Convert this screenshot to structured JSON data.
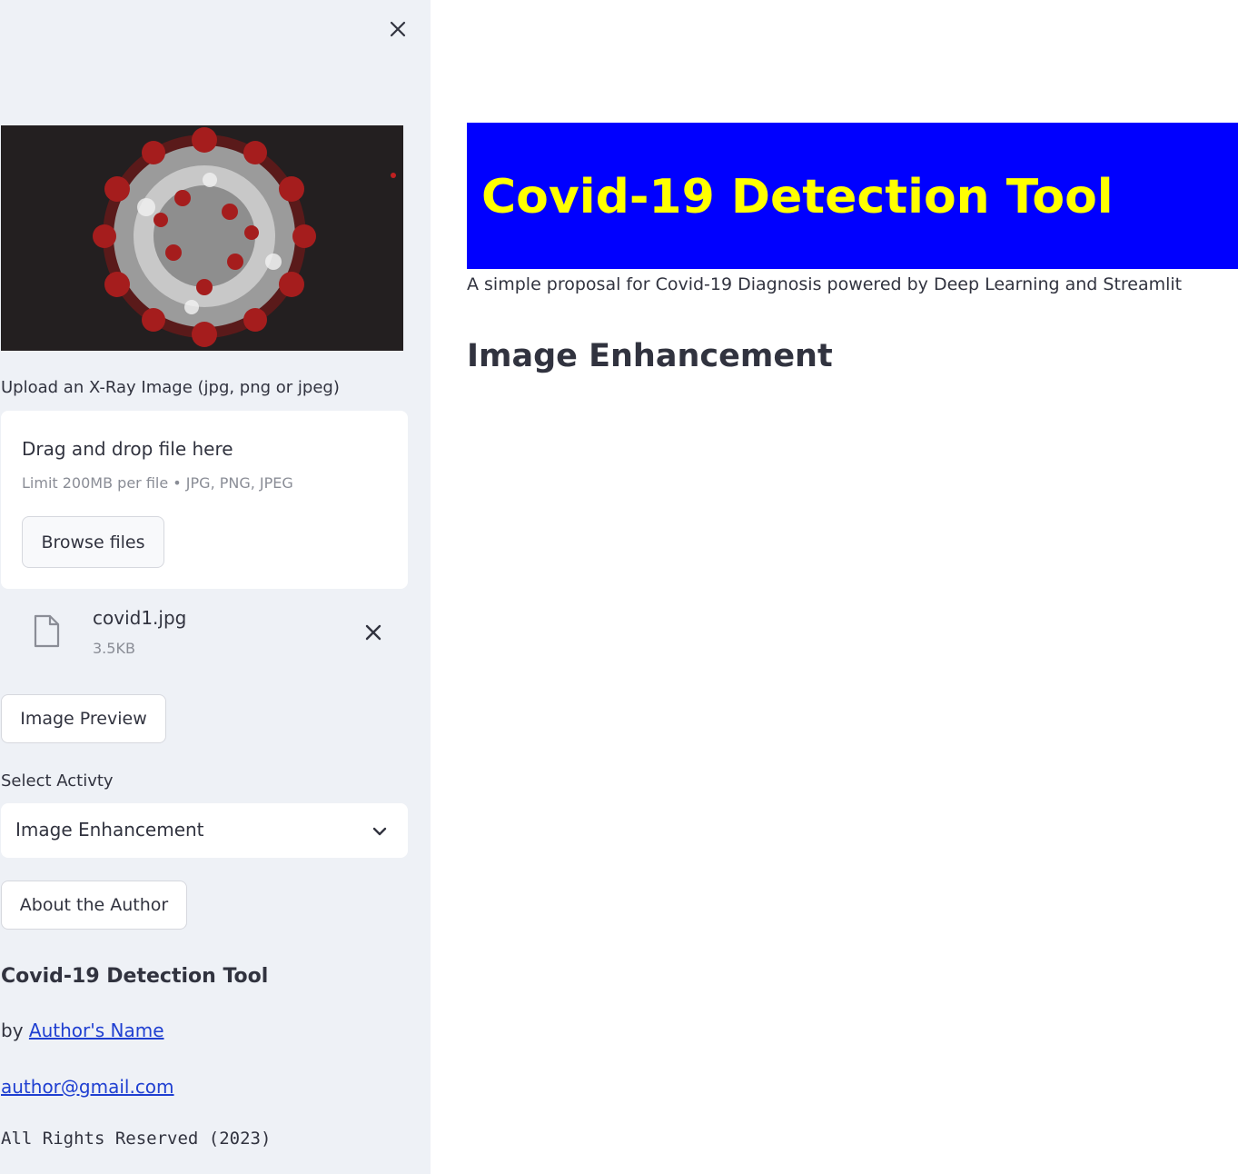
{
  "sidebar": {
    "close_icon": "close-icon",
    "hero_image": "coronavirus-illustration",
    "upload": {
      "label": "Upload an X-Ray Image (jpg, png or jpeg)",
      "dropzone_title": "Drag and drop file here",
      "dropzone_limit": "Limit 200MB per file • JPG, PNG, JPEG",
      "browse_label": "Browse files"
    },
    "uploaded_file": {
      "name": "covid1.jpg",
      "size": "3.5KB",
      "icon": "file-icon"
    },
    "preview_button": "Image Preview",
    "select": {
      "label": "Select Activty",
      "value": "Image Enhancement"
    },
    "author_button": "About the Author",
    "footer": {
      "title": "Covid-19 Detection Tool",
      "by_prefix": "by",
      "author_link": "Author's Name",
      "email": "author@gmail.com",
      "rights": "All Rights Reserved (2023)"
    }
  },
  "main": {
    "banner_title": "Covid-19 Detection Tool",
    "subtitle": "A simple proposal for Covid-19 Diagnosis powered by Deep Learning and Streamlit",
    "section_heading": "Image Enhancement"
  },
  "colors": {
    "sidebar_bg": "#eef1f6",
    "banner_bg": "#0000ff",
    "banner_text": "#ffff00",
    "link": "#1f3fd1"
  }
}
